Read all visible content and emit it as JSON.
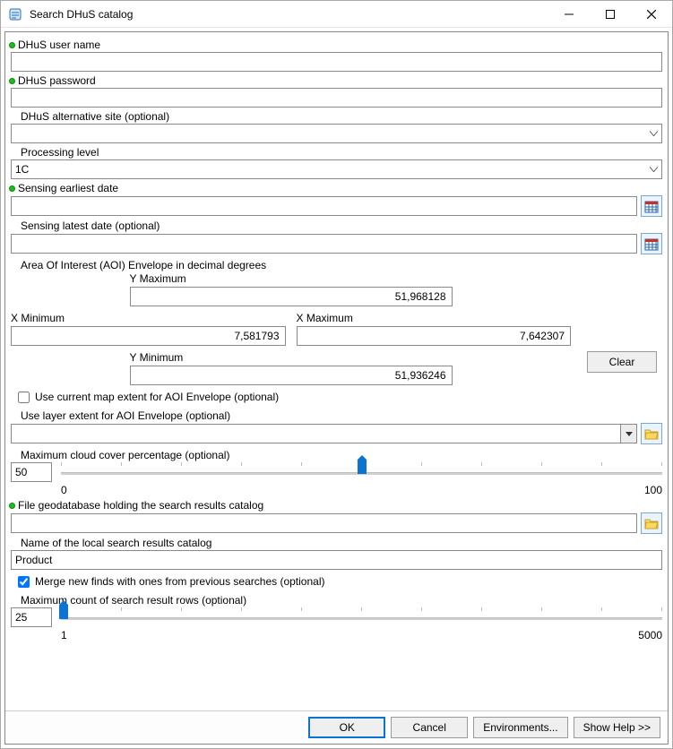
{
  "window": {
    "title": "Search DHuS catalog"
  },
  "fields": {
    "user": {
      "label": "DHuS user name",
      "value": ""
    },
    "pass": {
      "label": "DHuS password",
      "value": ""
    },
    "altsite": {
      "label": "DHuS alternative site (optional)",
      "value": ""
    },
    "proclevel": {
      "label": "Processing level",
      "value": "1C"
    },
    "earliest": {
      "label": "Sensing earliest date",
      "value": ""
    },
    "latest": {
      "label": "Sensing latest date (optional)",
      "value": ""
    },
    "aoi_heading": "Area Of Interest (AOI) Envelope in decimal degrees",
    "aoi": {
      "ymax_label": "Y Maximum",
      "ymax": "51,968128",
      "xmin_label": "X Minimum",
      "xmin": "7,581793",
      "xmax_label": "X Maximum",
      "xmax": "7,642307",
      "ymin_label": "Y Minimum",
      "ymin": "51,936246",
      "clear": "Clear"
    },
    "use_current_extent": {
      "label": "Use current map extent for AOI Envelope (optional)",
      "checked": false
    },
    "layer_extent": {
      "label": "Use layer extent for AOI Envelope (optional)",
      "value": ""
    },
    "cloud": {
      "label": "Maximum cloud cover percentage (optional)",
      "value": "50",
      "min": "0",
      "max": "100",
      "pct": 50
    },
    "gdb": {
      "label": "File geodatabase holding the search results catalog",
      "value": ""
    },
    "catalog_name": {
      "label": "Name of the local search results catalog",
      "value": "Product"
    },
    "merge": {
      "label": "Merge new finds with ones from previous searches (optional)",
      "checked": true
    },
    "maxrows": {
      "label": "Maximum count of search result rows (optional)",
      "value": "25",
      "min": "1",
      "max": "5000",
      "pct": 0.5
    }
  },
  "footer": {
    "ok": "OK",
    "cancel": "Cancel",
    "env": "Environments...",
    "help": "Show Help >>"
  }
}
